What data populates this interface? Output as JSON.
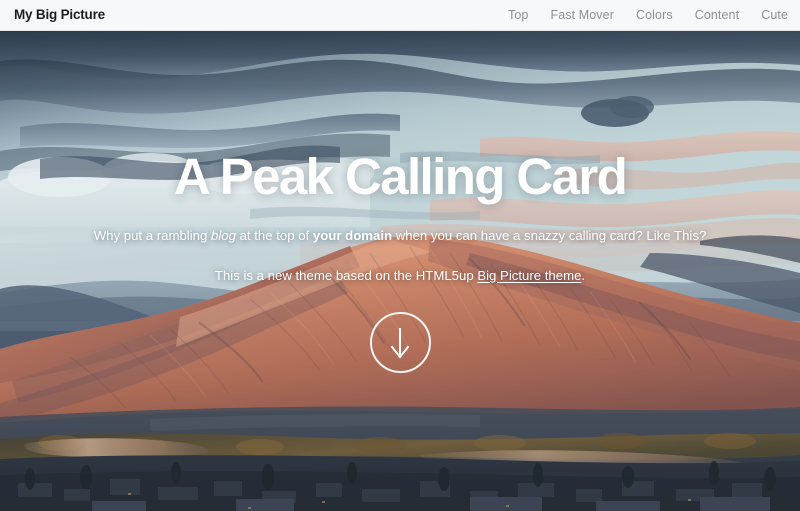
{
  "header": {
    "brand": "My Big Picture",
    "nav": [
      {
        "label": "Top"
      },
      {
        "label": "Fast Mover"
      },
      {
        "label": "Colors"
      },
      {
        "label": "Content"
      },
      {
        "label": "Cute"
      }
    ]
  },
  "hero": {
    "title": "A Peak Calling Card",
    "subtitle": {
      "part1": "Why put a rambling ",
      "italic": "blog",
      "part2": " at the top of ",
      "bold": "your domain",
      "part3": " when you can have a snazzy calling card? Like This?"
    },
    "note": {
      "prefix": "This is a new theme based on the HTML5up ",
      "link": "Big Picture theme",
      "suffix": "."
    },
    "scroll_icon": "arrow-down-icon",
    "image_alt": "Sunset over a mountain ridge above a valley town"
  },
  "colors": {
    "header_bg": "#f7f8f9",
    "header_border": "#e4e6e8",
    "brand_text": "#1b1f23",
    "nav_text": "#8e9194",
    "hero_text": "#ffffff",
    "sky_pale": "#cfdbe0",
    "sky_deep": "#3f5368",
    "cloud_dark": "#394a5c",
    "cloud_warm": "#e3bcae",
    "mountain_lit": "#c9765c",
    "mountain_light": "#d98f71",
    "mountain_shadow": "#7e5a5c",
    "ridge_far": "#6c7f92",
    "valley": "#3b4450",
    "town_dark": "#2e3540",
    "water_glow": "#c9a58c"
  }
}
